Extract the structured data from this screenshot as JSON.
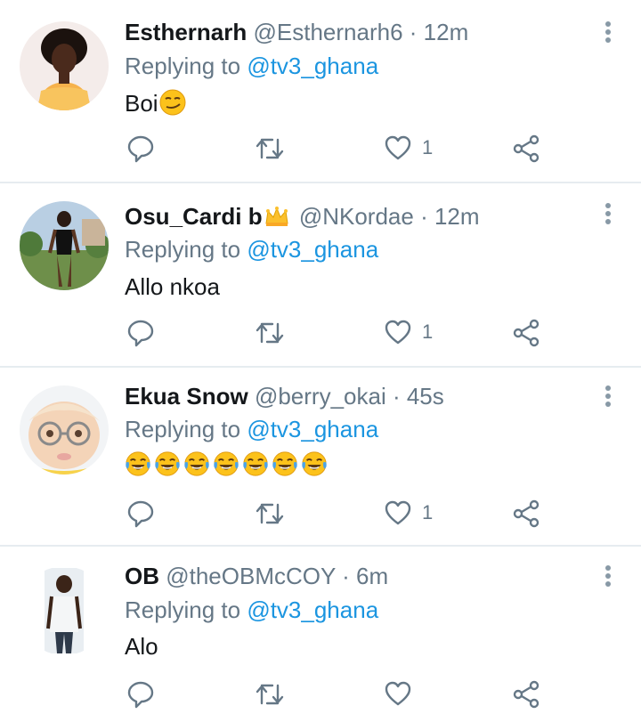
{
  "replies": [
    {
      "display_name": "Esthernarh",
      "handle": "@Esthernarh6",
      "separator": " · ",
      "time": "12m",
      "replying_prefix": "Replying to ",
      "replying_to": "@tv3_ghana",
      "text": "Boi",
      "emoji": [
        "smirking-face"
      ],
      "like_count": "1"
    },
    {
      "display_name": "Osu_Cardi b",
      "name_emoji": "crown",
      "handle": "@NKordae",
      "separator": " · ",
      "time": "12m",
      "replying_prefix": "Replying to ",
      "replying_to": "@tv3_ghana",
      "text": "Allo nkoa",
      "emoji": [],
      "like_count": "1"
    },
    {
      "display_name": "Ekua Snow",
      "handle": "@berry_okai",
      "separator": " · ",
      "time": "45s",
      "replying_prefix": "Replying to ",
      "replying_to": "@tv3_ghana",
      "text": "",
      "emoji": [
        "face-with-tears-of-joy",
        "face-with-tears-of-joy",
        "face-with-tears-of-joy",
        "face-with-tears-of-joy",
        "face-with-tears-of-joy",
        "face-with-tears-of-joy",
        "face-with-tears-of-joy"
      ],
      "like_count": "1"
    },
    {
      "display_name": "OB",
      "handle": "@theOBMcCOY",
      "separator": " · ",
      "time": "6m",
      "replying_prefix": "Replying to ",
      "replying_to": "@tv3_ghana",
      "text": "Alo",
      "emoji": [],
      "like_count": ""
    }
  ],
  "icons": {
    "reply": "reply-icon",
    "retweet": "retweet-icon",
    "like": "heart-icon",
    "share": "share-icon",
    "more": "more-options-icon"
  },
  "colors": {
    "name": "#14171a",
    "secondary": "#657786",
    "mention": "#1b95e0",
    "divider": "#e6ecf0",
    "icon": "#657786"
  }
}
